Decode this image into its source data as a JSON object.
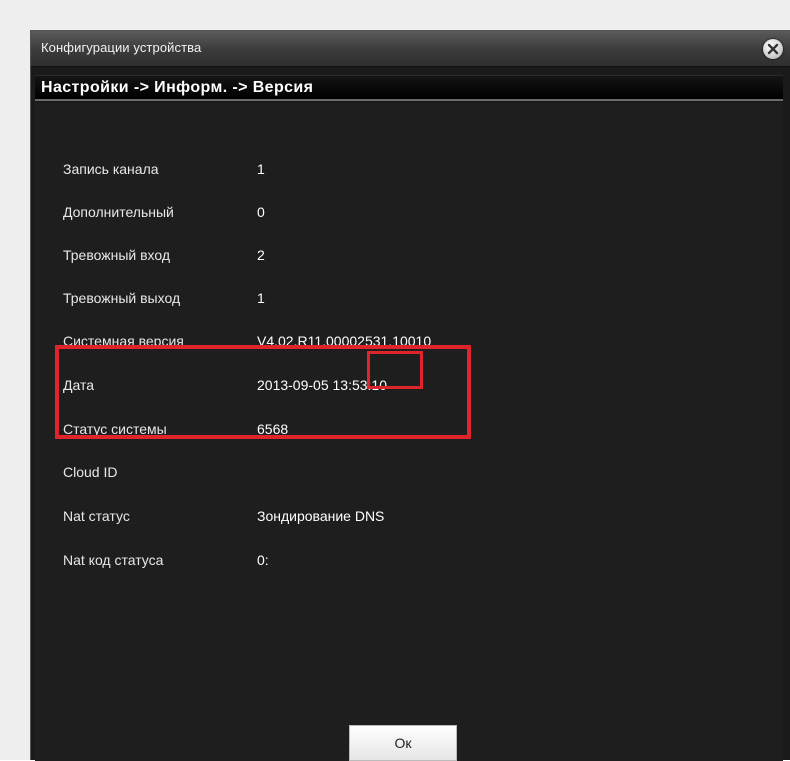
{
  "window": {
    "title": "Конфигурации устройства",
    "breadcrumb": "Настройки -> Информ. -> Версия"
  },
  "info_rows": [
    {
      "label": "Запись канала",
      "value": "1"
    },
    {
      "label": "Дополнительный",
      "value": "0"
    },
    {
      "label": "Тревожный вход",
      "value": "2"
    },
    {
      "label": "Тревожный выход",
      "value": "1"
    },
    {
      "label": "Системная версия",
      "value": "V4.02.R11.00002531.10010"
    },
    {
      "label": "Дата",
      "value": "2013-09-05 13:53:10"
    },
    {
      "label": "Статус системы",
      "value": "6568"
    },
    {
      "label": "Cloud ID",
      "value": ""
    },
    {
      "label": "Nat статус",
      "value": "Зондирование DNS"
    },
    {
      "label": "Nat код статуса",
      "value": "0:"
    }
  ],
  "buttons": {
    "ok_label": "Ок"
  },
  "icons": {
    "close": "close-icon"
  },
  "colors": {
    "highlight": "#e0242b",
    "background": "#1e1e1e"
  }
}
